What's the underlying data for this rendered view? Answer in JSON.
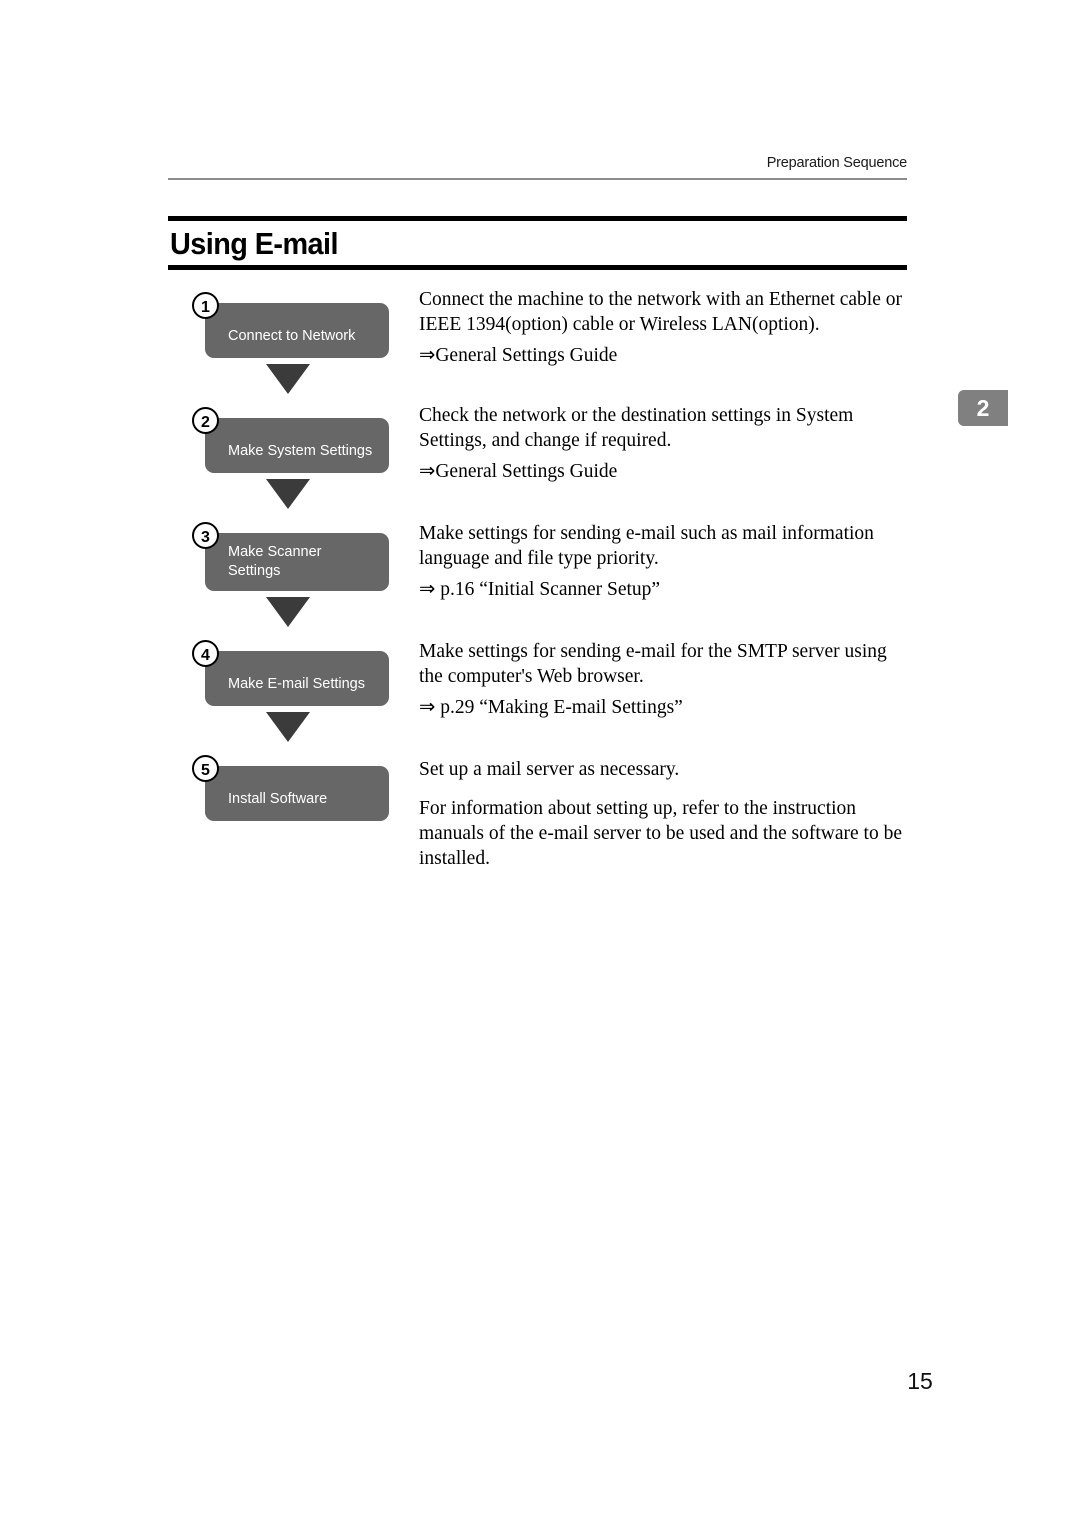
{
  "header": {
    "running_head": "Preparation Sequence"
  },
  "title": "Using E-mail",
  "chapter_tab": {
    "label": "2",
    "color": "#808080"
  },
  "flow": {
    "box_color": "#676767",
    "arrow_color": "#3b3b3b",
    "steps": [
      {
        "number": "1",
        "label": "Connect to Network"
      },
      {
        "number": "2",
        "label": "Make System Settings"
      },
      {
        "number": "3",
        "label_line1": "Make Scanner",
        "label_line2": "Settings"
      },
      {
        "number": "4",
        "label": "Make E-mail Settings"
      },
      {
        "number": "5",
        "label": "Install Software"
      }
    ]
  },
  "descriptions": [
    {
      "body": "Connect the machine to the network with an Ethernet cable or IEEE 1394(option) cable or Wireless LAN(option).",
      "reference": "⇒General Settings Guide"
    },
    {
      "body": "Check the network or the destination settings in System Settings, and change if required.",
      "reference": "⇒General Settings Guide"
    },
    {
      "body": "Make settings for sending e-mail such as mail information language and file type priority.",
      "reference": "⇒ p.16 “Initial Scanner Setup”"
    },
    {
      "body": "Make settings for sending e-mail for the SMTP server using the computer's Web browser.",
      "reference": "⇒ p.29 “Making E-mail Settings”"
    },
    {
      "body": "Set up a mail server as necessary.",
      "body2": "For information about setting up, refer to the instruction manuals of the e-mail server to be used and the software to be installed."
    }
  ],
  "folio": "15"
}
